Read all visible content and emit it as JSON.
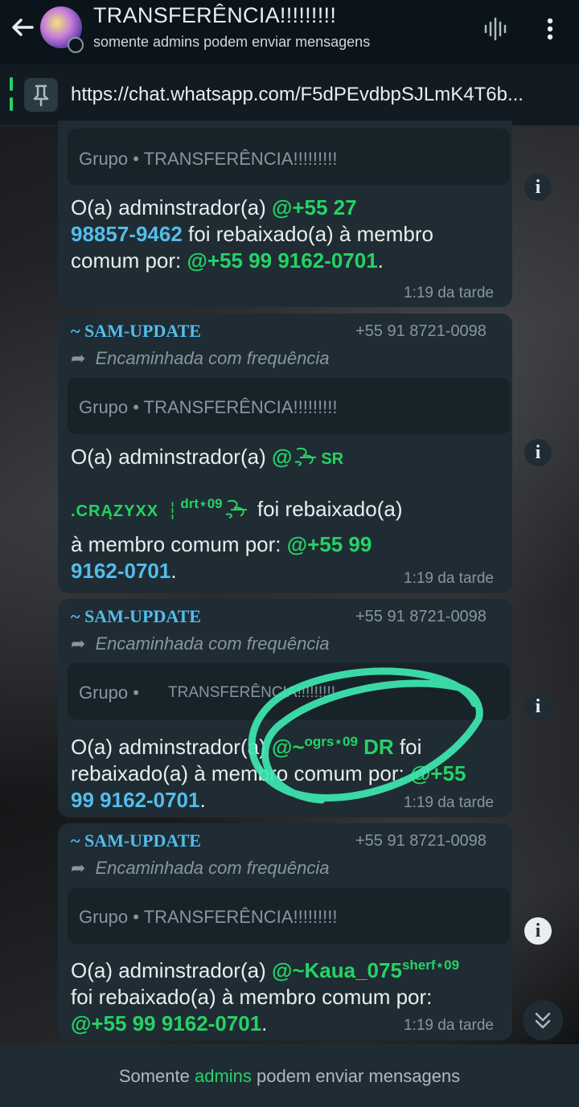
{
  "header": {
    "title": "TRANSFERÊNCIA!!!!!!!!!",
    "subtitle": "somente admins podem enviar mensagens"
  },
  "pinned": {
    "link": "https://chat.whatsapp.com/F5dPEvdbpSJLmK4T6b..."
  },
  "messages": [
    {
      "quote": "Grupo • TRANSFERÊNCIA!!!!!!!!!",
      "parts": [
        "O(a) adminstrador(a) ",
        "@+55 27",
        "98857-9462",
        " foi rebaixado(a) à membro",
        "comum por: ",
        "@+55 99 9162-0701",
        "."
      ],
      "time": "1:19 da tarde"
    },
    {
      "sender": "~ SAM-UPDATE",
      "phone": "+55 91 8721-0098",
      "forwarded": "Encaminhada com frequência",
      "quote": "Grupo • TRANSFERÊNCIA!!!!!!!!!",
      "parts": [
        "O(a) adminstrador(a) ",
        "@",
        "SR",
        ".CRĄZYXX",
        "drt⋆09",
        " foi rebaixado(a)",
        "à membro comum por: ",
        "@+55 99",
        "9162-0701",
        "."
      ],
      "time": "1:19 da tarde"
    },
    {
      "sender": "~ SAM-UPDATE",
      "phone": "+55 91 8721-0098",
      "forwarded": "Encaminhada com frequência",
      "quote_group": "Grupo •",
      "quote_name": "TRANSFERÊNCIA!!!!!!!!!",
      "parts": [
        "O(a) adminstrador(a) ",
        "@~",
        "ogrs⋆09",
        " DR",
        " foi",
        "rebaixado(a) à membro comum por: ",
        "@+55",
        "99 9162-0701",
        "."
      ],
      "time": "1:19 da tarde"
    },
    {
      "sender": "~ SAM-UPDATE",
      "phone": "+55 91 8721-0098",
      "forwarded": "Encaminhada com frequência",
      "quote": "Grupo • TRANSFERÊNCIA!!!!!!!!!",
      "parts": [
        "O(a) adminstrador(a) ",
        "@~Kaua_075",
        "sherf⋆09",
        "foi rebaixado(a) à membro comum por:",
        "@+55 99 9162-0701",
        "."
      ],
      "time": "1:19 da tarde"
    }
  ],
  "footer": {
    "before": "Somente ",
    "highlight": "admins",
    "after": " podem enviar mensagens"
  },
  "icons": {
    "back": "arrow-left-icon",
    "voice": "waveform-icon",
    "more": "more-vertical-icon",
    "pin": "pin-icon",
    "info": "info-icon",
    "scroll": "chevron-double-down-icon"
  },
  "colors": {
    "background": "#0b141a",
    "bubble": "#1f2c33",
    "mention": "#25d366",
    "phone": "#53bdeb",
    "highlight_marker": "#3ee8b0"
  }
}
